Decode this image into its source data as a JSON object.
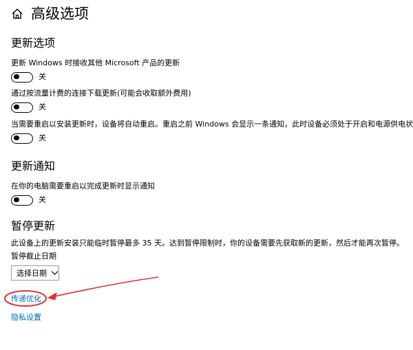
{
  "header": {
    "title": "高级选项",
    "home_icon": "home-icon"
  },
  "update_options": {
    "title": "更新选项",
    "items": [
      {
        "description": "更新 Windows 时接收其他 Microsoft 产品的更新",
        "state": "关"
      },
      {
        "description": "通过按流量计费的连接下载更新(可能会收取额外费用)",
        "state": "关"
      },
      {
        "description": "当需要重启以安装更新时，设备将自动重启。重启之前 Windows 会显示一条通知，此时设备必须处于开启和电源供电状态。",
        "state": "关"
      }
    ]
  },
  "update_notifications": {
    "title": "更新通知",
    "items": [
      {
        "description": "在你的电脑需要重启以完成更新时显示通知",
        "state": "关"
      }
    ]
  },
  "pause_updates": {
    "title": "暂停更新",
    "description": "此设备上的更新安装只能临时暂停最多 35 天。达到暂停限制时，你的设备需要先获取新的更新，然后才能再次暂停。",
    "date_label": "暂停截止日期",
    "select_value": "选择日期"
  },
  "links": {
    "delivery_optimization": "传递优化",
    "privacy_settings": "隐私设置"
  },
  "colors": {
    "link": "#0067b8",
    "annotation": "#e03030"
  }
}
